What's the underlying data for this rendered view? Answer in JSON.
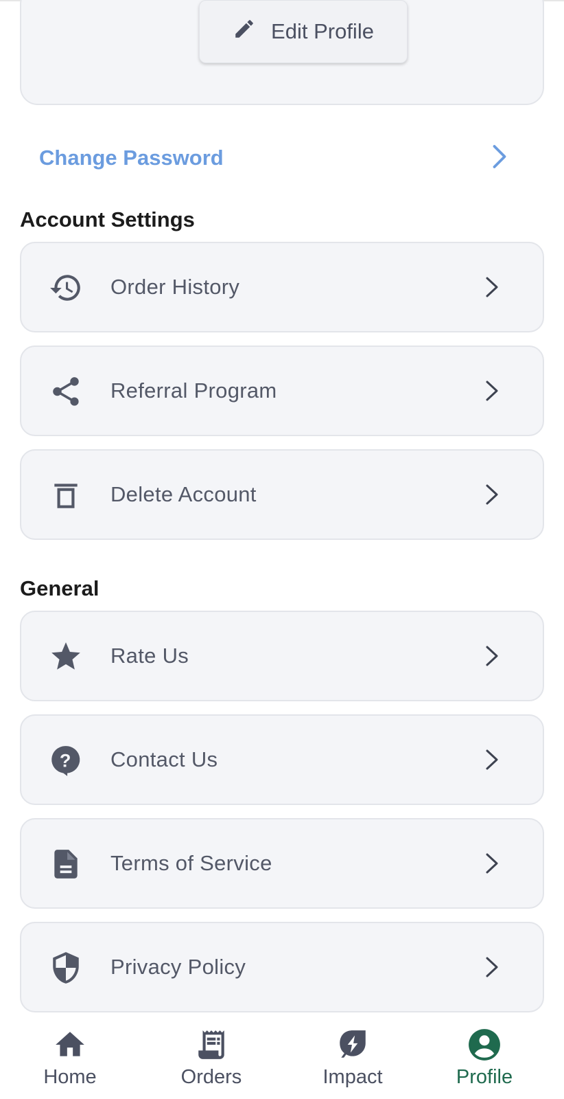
{
  "profile_card": {
    "edit_label": "Edit Profile"
  },
  "change_password": {
    "label": "Change Password"
  },
  "account_settings": {
    "title": "Account Settings",
    "items": [
      {
        "label": "Order History",
        "icon": "history-icon"
      },
      {
        "label": "Referral Program",
        "icon": "share-icon"
      },
      {
        "label": "Delete Account",
        "icon": "trash-icon"
      }
    ]
  },
  "general": {
    "title": "General",
    "items": [
      {
        "label": "Rate Us",
        "icon": "star-icon"
      },
      {
        "label": "Contact Us",
        "icon": "help-icon"
      },
      {
        "label": "Terms of Service",
        "icon": "document-icon"
      },
      {
        "label": "Privacy Policy",
        "icon": "shield-icon"
      }
    ]
  },
  "bottom_nav": {
    "items": [
      {
        "label": "Home",
        "icon": "home-icon",
        "active": false
      },
      {
        "label": "Orders",
        "icon": "receipt-icon",
        "active": false
      },
      {
        "label": "Impact",
        "icon": "impact-icon",
        "active": false
      },
      {
        "label": "Profile",
        "icon": "account-circle-icon",
        "active": true
      }
    ]
  },
  "colors": {
    "accent_green": "#1f6a4e",
    "link_blue": "#6b9cdf",
    "icon_gray": "#535867",
    "card_bg": "#f4f5f8"
  }
}
